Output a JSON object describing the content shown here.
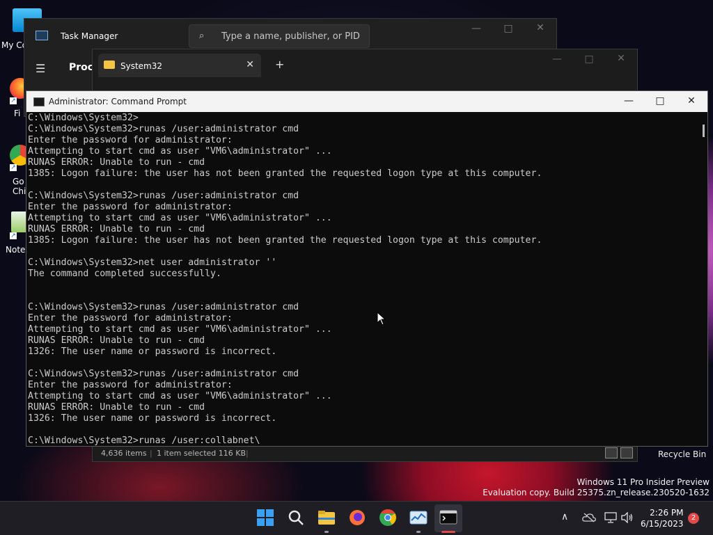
{
  "desktop": {
    "icons": [
      {
        "label": "My Co",
        "name": "this-pc"
      },
      {
        "label": "Fi",
        "name": "firefox"
      },
      {
        "label": "Go\nChi",
        "name": "google-chrome"
      },
      {
        "label": "Note",
        "name": "notepad"
      }
    ],
    "recycle_bin_label": "Recycle Bin",
    "watermark_line1": "Windows 11 Pro Insider Preview",
    "watermark_line2": "Evaluation copy. Build 25375.zn_release.230520-1632"
  },
  "task_manager": {
    "title": "Task Manager",
    "search_placeholder": "Type a name, publisher, or PID...",
    "nav_label": "Proc"
  },
  "explorer": {
    "tab_label": "System32",
    "status_items": "4,636 items",
    "status_selected": "1 item selected  116 KB"
  },
  "cmd": {
    "title": "Administrator: Command Prompt",
    "lines": [
      "C:\\Windows\\System32>",
      "C:\\Windows\\System32>runas /user:administrator cmd",
      "Enter the password for administrator:",
      "Attempting to start cmd as user \"VM6\\administrator\" ...",
      "RUNAS ERROR: Unable to run - cmd",
      "1385: Logon failure: the user has not been granted the requested logon type at this computer.",
      "",
      "C:\\Windows\\System32>runas /user:administrator cmd",
      "Enter the password for administrator:",
      "Attempting to start cmd as user \"VM6\\administrator\" ...",
      "RUNAS ERROR: Unable to run - cmd",
      "1385: Logon failure: the user has not been granted the requested logon type at this computer.",
      "",
      "C:\\Windows\\System32>net user administrator ''",
      "The command completed successfully.",
      "",
      "",
      "C:\\Windows\\System32>runas /user:administrator cmd",
      "Enter the password for administrator:",
      "Attempting to start cmd as user \"VM6\\administrator\" ...",
      "RUNAS ERROR: Unable to run - cmd",
      "1326: The user name or password is incorrect.",
      "",
      "C:\\Windows\\System32>runas /user:administrator cmd",
      "Enter the password for administrator:",
      "Attempting to start cmd as user \"VM6\\administrator\" ...",
      "RUNAS ERROR: Unable to run - cmd",
      "1326: The user name or password is incorrect.",
      "",
      "C:\\Windows\\System32>runas /user:collabnet\\"
    ]
  },
  "taskbar": {
    "apps": [
      "start",
      "search",
      "file-explorer",
      "firefox",
      "chrome",
      "task-manager",
      "terminal"
    ],
    "clock_time": "2:26 PM",
    "clock_date": "6/15/2023",
    "notification_count": "2"
  },
  "colors": {
    "accent": "#0078d4",
    "cmd_text": "#cccccc",
    "cmd_bg": "#0c0c0c"
  }
}
